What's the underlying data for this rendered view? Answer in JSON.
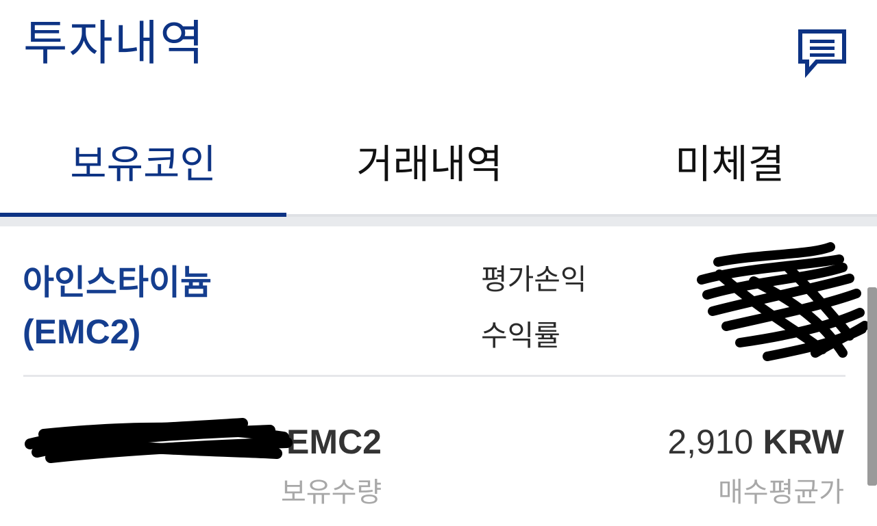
{
  "header": {
    "title": "투자내역",
    "chat_icon": "chat-icon"
  },
  "tabs": [
    {
      "label": "보유코인",
      "active": true
    },
    {
      "label": "거래내역",
      "active": false
    },
    {
      "label": "미체결",
      "active": false
    }
  ],
  "coin": {
    "name": "아인스타이늄",
    "ticker": "(EMC2)",
    "pnl_label": "평가손익",
    "roi_label": "수익률",
    "holding_unit": "EMC2",
    "holding_label": "보유수량",
    "avg_price_value": "2,910",
    "avg_price_currency": "KRW",
    "avg_price_label": "매수평균가"
  },
  "colors": {
    "brand": "#0d3384",
    "text": "#333333",
    "muted": "#a8a8a8"
  }
}
